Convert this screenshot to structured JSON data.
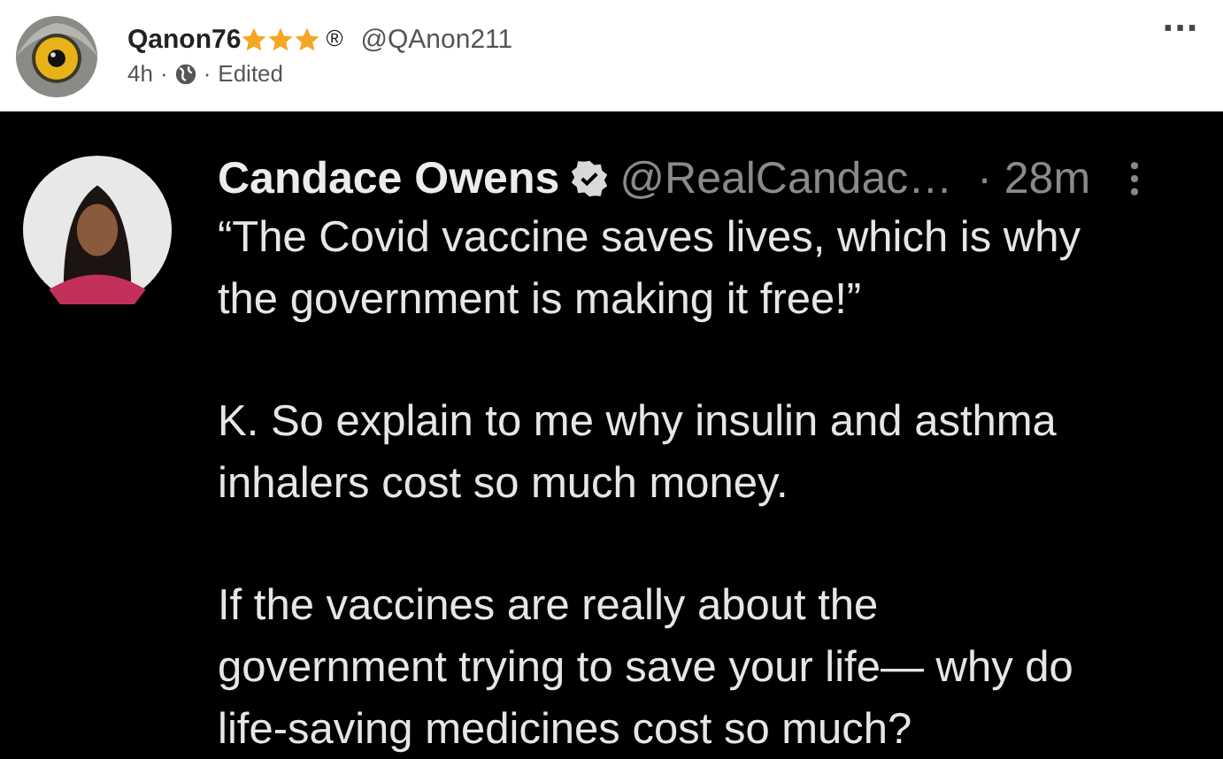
{
  "post": {
    "author": "Qanon76",
    "stars": 3,
    "registered": "®",
    "handle": "@QAnon211",
    "time": "4h",
    "separator": "·",
    "edited": "Edited",
    "menu": "···"
  },
  "tweet": {
    "name": "Candace Owens",
    "verified": true,
    "handle": "@RealCandac…",
    "time": "· 28m",
    "paragraphs": [
      "“The Covid vaccine saves lives, which is why\nthe government is making it free!”",
      "K. So explain to me why insulin and asthma\ninhalers cost so much money.",
      "If the vaccines are really about the\ngovernment trying to save your life— why do\nlife-saving medicines cost so much?"
    ]
  }
}
